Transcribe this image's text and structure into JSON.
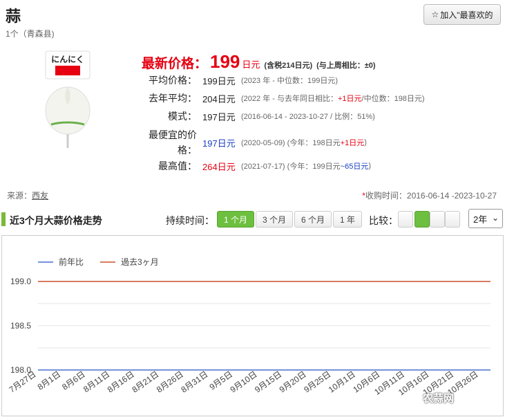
{
  "header": {
    "title": "蒜",
    "subtitle": "1个（青森县)",
    "fav_label": "加入\"最喜欢的"
  },
  "product": {
    "image_text": "にんにく"
  },
  "latest": {
    "label": "最新价格：",
    "value": "199",
    "unit": "日元",
    "tax": "(含税214日元)",
    "compare": "(与上周相比：±0)"
  },
  "rows": [
    {
      "key": "平均价格：",
      "value": "199日元",
      "note": "(2023 年 - 中位数：199日元)"
    },
    {
      "key": "去年平均：",
      "value": "204日元",
      "note_a": "(2022 年 - 与去年同日相比：",
      "note_b": "+1日元",
      "note_c": "/中位数：198日元)"
    },
    {
      "key": "模式：",
      "value": "197日元",
      "note": "(2016-06-14 - 2023-10-27 / 比例：51%)"
    },
    {
      "key_l1": "最便宜的价",
      "key_l2": "格：",
      "value": "197日元",
      "note_a": "(2020-05-09) (今年：198日元 ",
      "note_b": "+1日元",
      "note_c": ")"
    },
    {
      "key": "最高值：",
      "value": "264日元",
      "note_a": "(2021-07-17) (今年：199日元 ",
      "note_b": "~65日元",
      "note_c": ")"
    }
  ],
  "source": {
    "label": "来源：",
    "value": "西友"
  },
  "collect": {
    "star": "*",
    "text": "收购时间：2016-06-14 -2023-10-27"
  },
  "section": {
    "title": "近3个月大蒜价格走势",
    "duration_label": "持续时间：",
    "durations": [
      "1 个月",
      "3 个月",
      "6 个月",
      "1 年"
    ],
    "active_duration": 0,
    "compare_label": "比较：",
    "year_value": "2年"
  },
  "colors": {
    "accent": "#6dbf3f",
    "price_red": "#e60012",
    "series_prev": "#4a6fd1",
    "series_past": "#c8502a"
  },
  "chart_data": {
    "type": "line",
    "series": [
      {
        "name": "前年比",
        "color": "#4a6fd1",
        "values": [
          198.0
        ]
      },
      {
        "name": "過去3ヶ月",
        "color": "#c8502a",
        "values": [
          199.0
        ]
      }
    ],
    "y_ticks": [
      "199.0",
      "198.5",
      "198.0"
    ],
    "ylim": [
      198.0,
      199.0
    ],
    "x_ticks": [
      "7月27日",
      "8月1日",
      "8月6日",
      "8月11日",
      "8月16日",
      "8月21日",
      "8月26日",
      "8月31日",
      "9月5日",
      "9月10日",
      "9月15日",
      "9月20日",
      "9月25日",
      "10月1日",
      "10月6日",
      "10月11日",
      "10月16日",
      "10月21日",
      "10月26日"
    ],
    "grid": true,
    "legend": "top-left"
  },
  "watermark": "农蒜网"
}
